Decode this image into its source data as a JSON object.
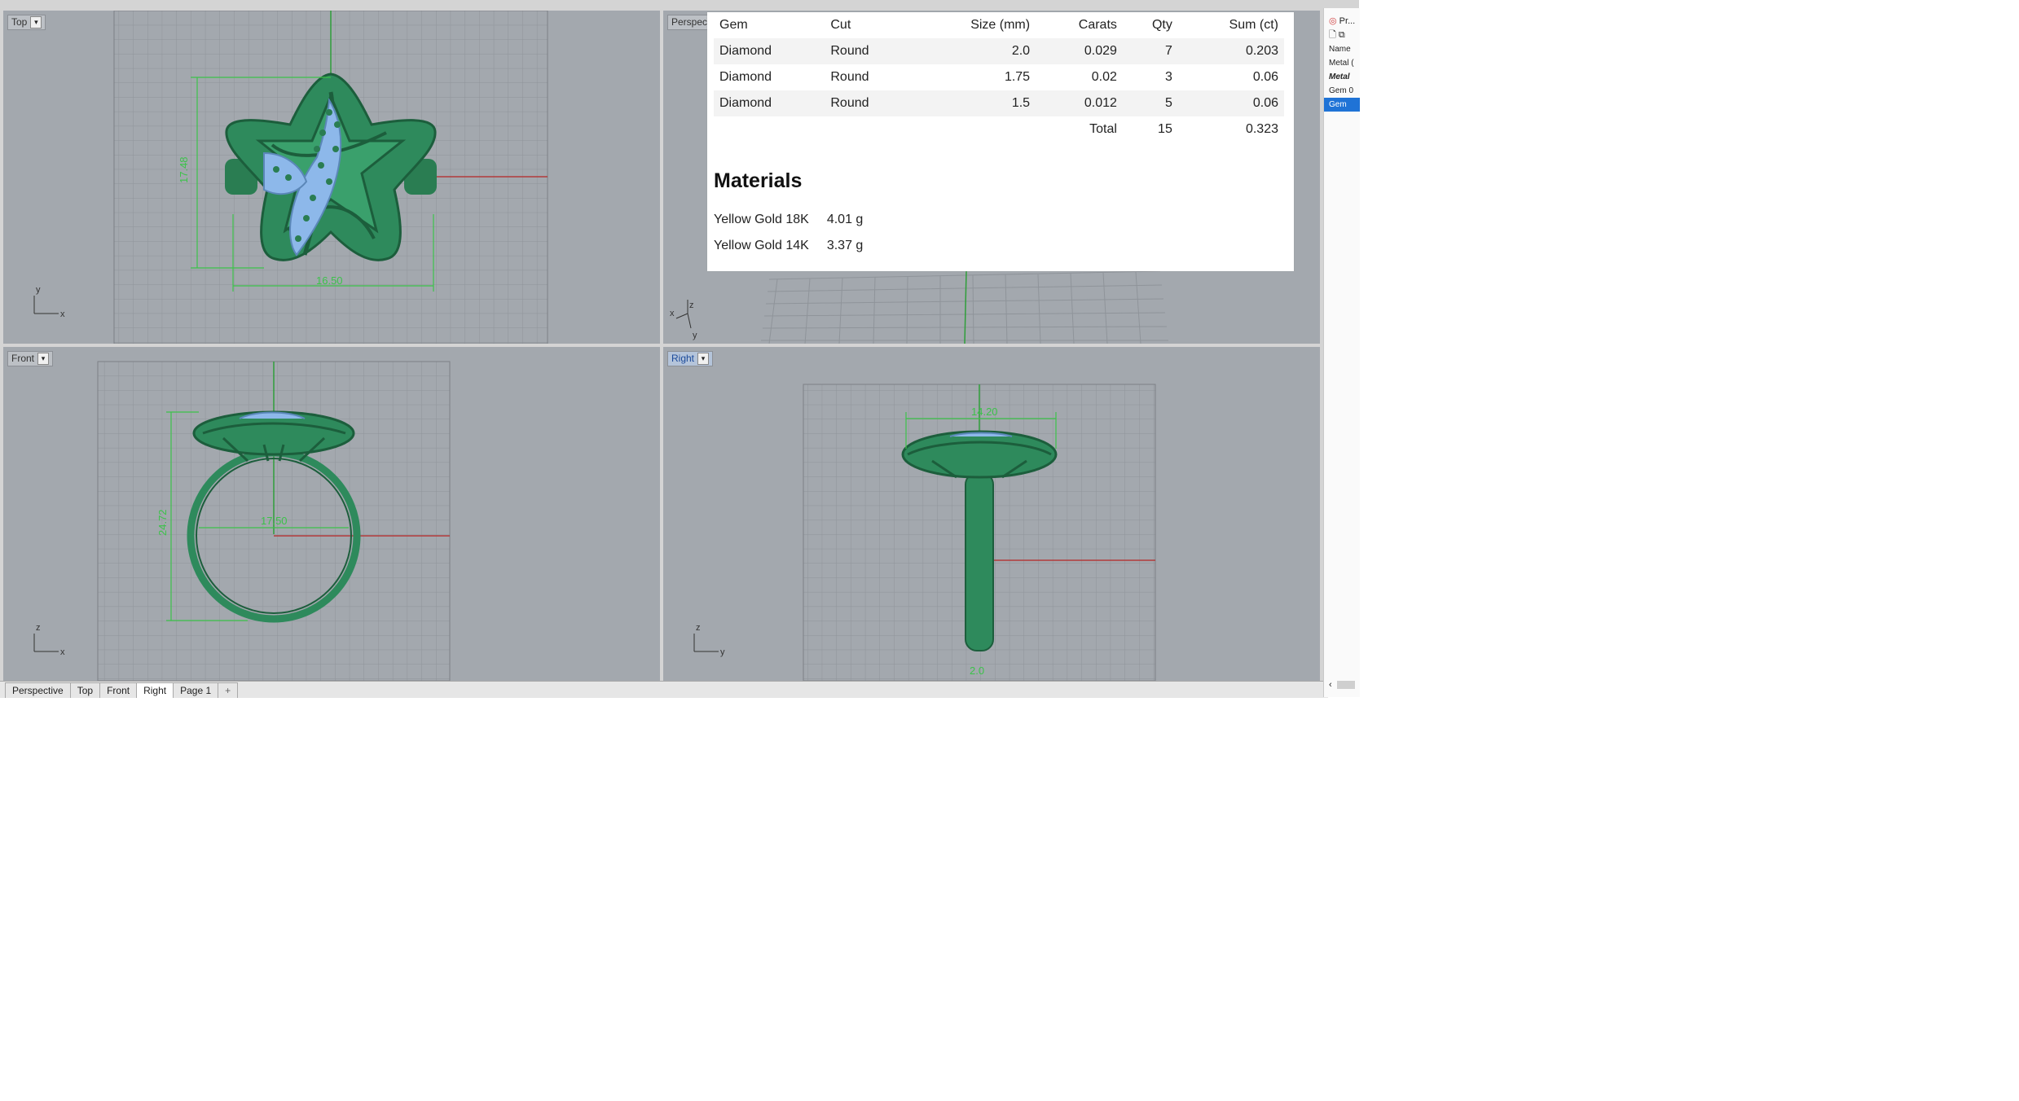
{
  "viewports": {
    "top": {
      "label": "Top",
      "dims": {
        "height": "17.48",
        "width": "16.50"
      },
      "axes": {
        "v": "y",
        "h": "x"
      }
    },
    "perspective": {
      "label": "Perspect",
      "axes": {
        "a": "x",
        "b": "z",
        "c": "y"
      }
    },
    "front": {
      "label": "Front",
      "dims": {
        "height": "24.72",
        "inner": "17.50"
      },
      "axes": {
        "v": "z",
        "h": "x"
      }
    },
    "right": {
      "label": "Right",
      "dims": {
        "width": "14.20",
        "band": "2.0"
      },
      "axes": {
        "v": "z",
        "h": "y"
      }
    }
  },
  "tabs": [
    "Perspective",
    "Top",
    "Front",
    "Right",
    "Page 1",
    "+"
  ],
  "active_tab": "Right",
  "properties_panel": {
    "title": "Pr...",
    "header": "Name",
    "rows": [
      "Metal (",
      "Metal",
      "Gem 0",
      "Gem"
    ]
  },
  "gem_report": {
    "columns": [
      "Gem",
      "Cut",
      "Size (mm)",
      "Carats",
      "Qty",
      "Sum (ct)"
    ],
    "rows": [
      [
        "Diamond",
        "Round",
        "2.0",
        "0.029",
        "7",
        "0.203"
      ],
      [
        "Diamond",
        "Round",
        "1.75",
        "0.02",
        "3",
        "0.06"
      ],
      [
        "Diamond",
        "Round",
        "1.5",
        "0.012",
        "5",
        "0.06"
      ]
    ],
    "total_label": "Total",
    "total_qty": "15",
    "total_sum": "0.323"
  },
  "materials": {
    "title": "Materials",
    "items": [
      {
        "name": "Yellow Gold 18K",
        "weight": "4.01 g"
      },
      {
        "name": "Yellow Gold 14K",
        "weight": "3.37 g"
      }
    ]
  },
  "colors": {
    "viewport_bg": "#a3a8ae",
    "grid": "#8f949a",
    "metal": "#2e8a5c",
    "gem": "#8db8ea",
    "dim": "#3cc24a",
    "axis_x": "#b23b3b",
    "axis_y": "#2f9e3a",
    "selection": "#1f73d6"
  }
}
